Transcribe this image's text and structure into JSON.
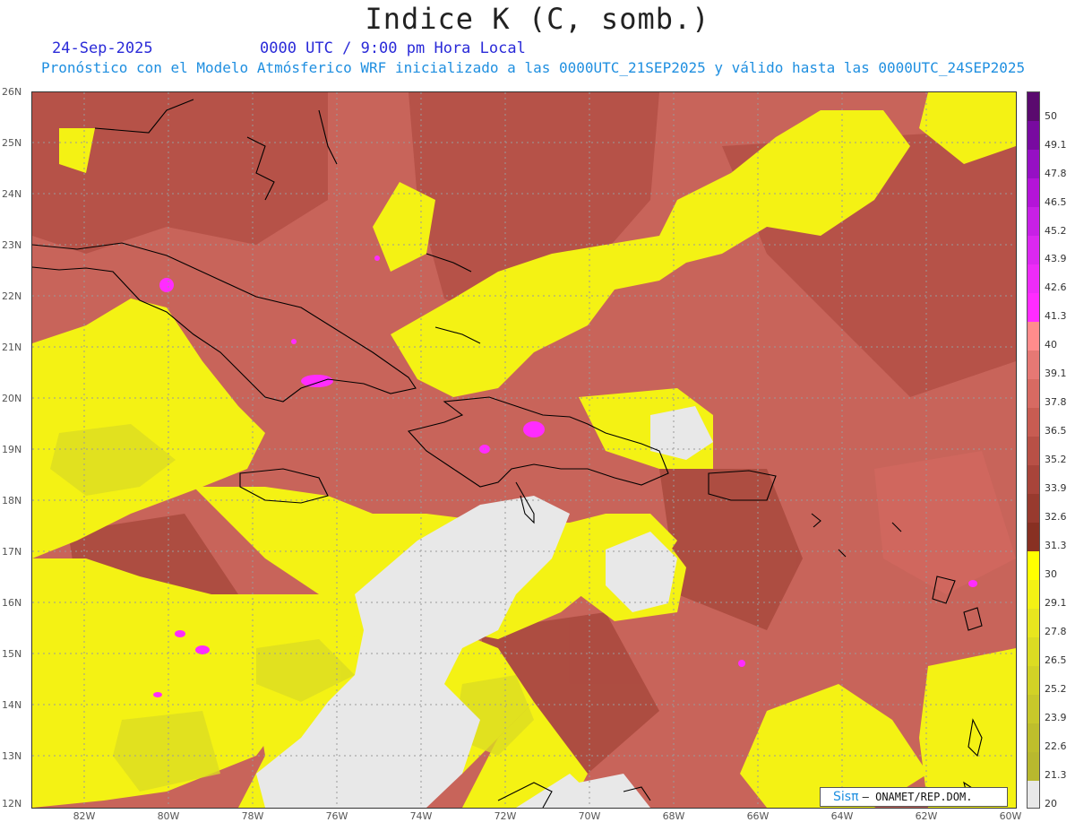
{
  "header": {
    "title": "Indice K (C, somb.)",
    "date": "24-Sep-2025",
    "time": "0000 UTC / 9:00 pm Hora Local",
    "subtitle": "Pronóstico con el Modelo Atmósferico WRF inicializado a las 0000UTC_21SEP2025 y válido hasta las  0000UTC_24SEP2025"
  },
  "map": {
    "lat_labels": [
      "26N",
      "25N",
      "24N",
      "23N",
      "22N",
      "21N",
      "20N",
      "19N",
      "18N",
      "17N",
      "16N",
      "15N",
      "14N",
      "13N",
      "12N"
    ],
    "lon_labels": [
      "82W",
      "80W",
      "78W",
      "76W",
      "74W",
      "72W",
      "70W",
      "68W",
      "66W",
      "64W",
      "62W",
      "60W"
    ]
  },
  "colorbar": {
    "labels": [
      "50",
      "49.1",
      "47.8",
      "46.5",
      "45.2",
      "43.9",
      "42.6",
      "41.3",
      "40",
      "39.1",
      "37.8",
      "36.5",
      "35.2",
      "33.9",
      "32.6",
      "31.3",
      "30",
      "29.1",
      "27.8",
      "26.5",
      "25.2",
      "23.9",
      "22.6",
      "21.3",
      "20"
    ],
    "colors": {
      "c50": "#5a0a6e",
      "c49": "#780aa0",
      "c47": "#9610c4",
      "c46": "#b414d8",
      "c45": "#c820e6",
      "c43": "#dc28f0",
      "c42": "#ee2cf8",
      "c41": "#ff2cff",
      "c40": "#ff8c8c",
      "c39": "#e67874",
      "c37": "#d76a62",
      "c36": "#c85c52",
      "c35": "#b85046",
      "c33": "#a8443a",
      "c32": "#983a2e",
      "c31": "#883022",
      "c30": "#ffff00",
      "c29": "#f4f214",
      "c27": "#e8e61e",
      "c26": "#dcdc22",
      "c25": "#d2d226",
      "c23": "#c8c82a",
      "c22": "#bebe2c",
      "c21": "#b8b82e",
      "c20": "#e8e8e8"
    }
  },
  "credit": {
    "logo": "Sisπ",
    "org": "– ONAMET/REP.DOM."
  }
}
